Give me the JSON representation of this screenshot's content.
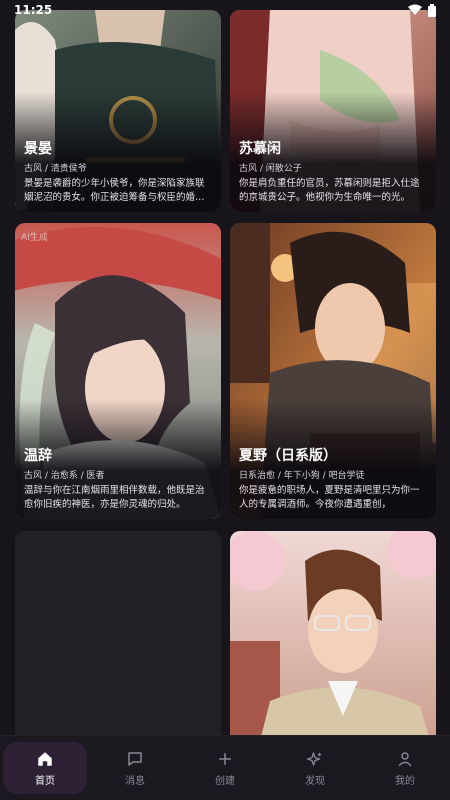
{
  "status": {
    "time": "11:25"
  },
  "cards": [
    {
      "name": "景晏",
      "tags": "古风 / 清贵侯爷",
      "desc": "景晏是袭爵的少年小侯爷，你是深陷家族联姻泥沼的贵女。你正被迫筹备与权臣的婚事。"
    },
    {
      "name": "苏慕闲",
      "tags": "古风 / 闲散公子",
      "desc": "你是肩负重任的官员，苏慕闲则是拒入仕途的京城贵公子。他视你为生命唯一的光。"
    },
    {
      "name": "温辞",
      "tags": "古风 / 治愈系 / 医者",
      "desc": "温辞与你在江南烟雨里相伴数载，他既是治愈你旧疾的神医，亦是你灵魂的归处。",
      "ai_tag": "AI生成"
    },
    {
      "name": "夏野（日系版）",
      "tags": "日系治愈 / 年下小狗 / 吧台学徒",
      "desc": "你是疲惫的职场人，夏野是清吧里只为你一人的专属调酒师。今夜你遭遇重创，"
    }
  ],
  "nav": [
    {
      "label": "首页",
      "icon": "home-icon"
    },
    {
      "label": "消息",
      "icon": "message-icon"
    },
    {
      "label": "创建",
      "icon": "plus-icon"
    },
    {
      "label": "发现",
      "icon": "sparkle-icon"
    },
    {
      "label": "我的",
      "icon": "user-icon"
    }
  ],
  "colors": {
    "background": "#17141c",
    "nav_active_bg": "#2e2136"
  }
}
